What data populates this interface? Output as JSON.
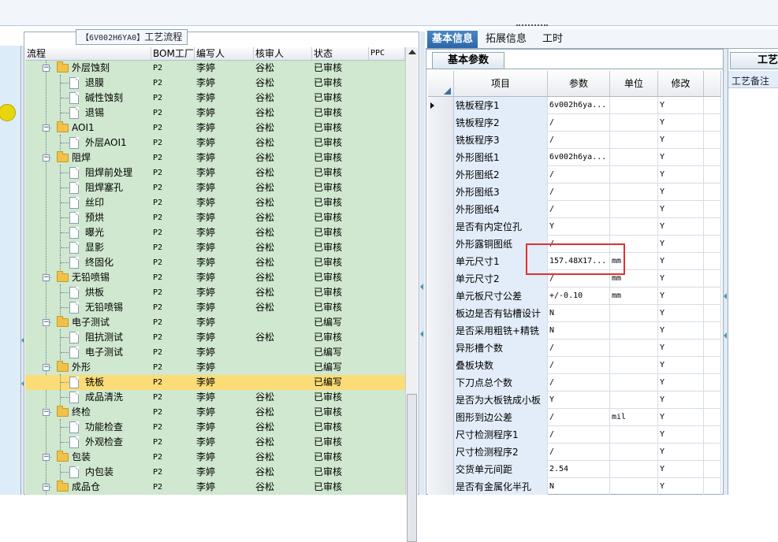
{
  "tree": {
    "caption_prefix": "【6V002H6YA0】",
    "caption_suffix": "工艺流程",
    "columns": [
      "流程",
      "BOM工厂",
      "编写人",
      "核审人",
      "状态",
      "PPC"
    ],
    "rows": [
      {
        "label": "外层蚀刻",
        "type": "folder",
        "bom": "P2",
        "writer": "李婷",
        "reviewer": "谷松",
        "status": "已审核"
      },
      {
        "label": "退膜",
        "type": "doc",
        "bom": "P2",
        "writer": "李婷",
        "reviewer": "谷松",
        "status": "已审核"
      },
      {
        "label": "碱性蚀刻",
        "type": "doc",
        "bom": "P2",
        "writer": "李婷",
        "reviewer": "谷松",
        "status": "已审核"
      },
      {
        "label": "退锡",
        "type": "doc",
        "bom": "P2",
        "writer": "李婷",
        "reviewer": "谷松",
        "status": "已审核"
      },
      {
        "label": "AOI1",
        "type": "folder",
        "bom": "P2",
        "writer": "李婷",
        "reviewer": "谷松",
        "status": "已审核"
      },
      {
        "label": "外层AOI1",
        "type": "doc",
        "bom": "P2",
        "writer": "李婷",
        "reviewer": "谷松",
        "status": "已审核"
      },
      {
        "label": "阻焊",
        "type": "folder",
        "bom": "P2",
        "writer": "李婷",
        "reviewer": "谷松",
        "status": "已审核"
      },
      {
        "label": "阻焊前处理",
        "type": "doc",
        "bom": "P2",
        "writer": "李婷",
        "reviewer": "谷松",
        "status": "已审核"
      },
      {
        "label": "阻焊塞孔",
        "type": "doc",
        "bom": "P2",
        "writer": "李婷",
        "reviewer": "谷松",
        "status": "已审核"
      },
      {
        "label": "丝印",
        "type": "doc",
        "bom": "P2",
        "writer": "李婷",
        "reviewer": "谷松",
        "status": "已审核"
      },
      {
        "label": "预烘",
        "type": "doc",
        "bom": "P2",
        "writer": "李婷",
        "reviewer": "谷松",
        "status": "已审核"
      },
      {
        "label": "曝光",
        "type": "doc",
        "bom": "P2",
        "writer": "李婷",
        "reviewer": "谷松",
        "status": "已审核"
      },
      {
        "label": "显影",
        "type": "doc",
        "bom": "P2",
        "writer": "李婷",
        "reviewer": "谷松",
        "status": "已审核"
      },
      {
        "label": "终固化",
        "type": "doc",
        "bom": "P2",
        "writer": "李婷",
        "reviewer": "谷松",
        "status": "已审核"
      },
      {
        "label": "无铅喷锡",
        "type": "folder",
        "bom": "P2",
        "writer": "李婷",
        "reviewer": "谷松",
        "status": "已审核"
      },
      {
        "label": "烘板",
        "type": "doc",
        "bom": "P2",
        "writer": "李婷",
        "reviewer": "谷松",
        "status": "已审核"
      },
      {
        "label": "无铅喷锡",
        "type": "doc",
        "bom": "P2",
        "writer": "李婷",
        "reviewer": "谷松",
        "status": "已审核"
      },
      {
        "label": "电子测试",
        "type": "folder",
        "bom": "P2",
        "writer": "李婷",
        "reviewer": "",
        "status": "已编写"
      },
      {
        "label": "阻抗测试",
        "type": "doc",
        "bom": "P2",
        "writer": "李婷",
        "reviewer": "谷松",
        "status": "已审核"
      },
      {
        "label": "电子测试",
        "type": "doc",
        "bom": "P2",
        "writer": "李婷",
        "reviewer": "",
        "status": "已编写"
      },
      {
        "label": "外形",
        "type": "folder",
        "bom": "P2",
        "writer": "李婷",
        "reviewer": "",
        "status": "已编写"
      },
      {
        "label": "铣板",
        "type": "doc",
        "bom": "P2",
        "writer": "李婷",
        "reviewer": "",
        "status": "已编写",
        "selected": true
      },
      {
        "label": "成品清洗",
        "type": "doc",
        "bom": "P2",
        "writer": "李婷",
        "reviewer": "谷松",
        "status": "已审核"
      },
      {
        "label": "终检",
        "type": "folder",
        "bom": "P2",
        "writer": "李婷",
        "reviewer": "谷松",
        "status": "已审核"
      },
      {
        "label": "功能检查",
        "type": "doc",
        "bom": "P2",
        "writer": "李婷",
        "reviewer": "谷松",
        "status": "已审核"
      },
      {
        "label": "外观检查",
        "type": "doc",
        "bom": "P2",
        "writer": "李婷",
        "reviewer": "谷松",
        "status": "已审核"
      },
      {
        "label": "包装",
        "type": "folder",
        "bom": "P2",
        "writer": "李婷",
        "reviewer": "谷松",
        "status": "已审核"
      },
      {
        "label": "内包装",
        "type": "doc",
        "bom": "P2",
        "writer": "李婷",
        "reviewer": "谷松",
        "status": "已审核"
      },
      {
        "label": "成品仓",
        "type": "folder",
        "bom": "P2",
        "writer": "李婷",
        "reviewer": "谷松",
        "status": "已审核"
      }
    ]
  },
  "tabs": [
    "基本信息",
    "拓展信息",
    "工时"
  ],
  "params": {
    "subtab": "基本参数",
    "columns": [
      "项目",
      "参数",
      "单位",
      "修改"
    ],
    "rows": [
      {
        "name": "铣板程序1",
        "value": "6v002h6ya...",
        "unit": "",
        "mod": "Y",
        "current": true
      },
      {
        "name": "铣板程序2",
        "value": "/",
        "unit": "",
        "mod": "Y"
      },
      {
        "name": "铣板程序3",
        "value": "/",
        "unit": "",
        "mod": "Y"
      },
      {
        "name": "外形图纸1",
        "value": "6v002h6ya...",
        "unit": "",
        "mod": "Y"
      },
      {
        "name": "外形图纸2",
        "value": "/",
        "unit": "",
        "mod": "Y"
      },
      {
        "name": "外形图纸3",
        "value": "/",
        "unit": "",
        "mod": "Y"
      },
      {
        "name": "外形图纸4",
        "value": "/",
        "unit": "",
        "mod": "Y"
      },
      {
        "name": "是否有内定位孔",
        "value": "Y",
        "unit": "",
        "mod": "Y"
      },
      {
        "name": "外形露铜图纸",
        "value": "/",
        "unit": "",
        "mod": "Y"
      },
      {
        "name": "单元尺寸1",
        "value": "157.48X17...",
        "unit": "mm",
        "mod": "Y"
      },
      {
        "name": "单元尺寸2",
        "value": "/",
        "unit": "mm",
        "mod": "Y"
      },
      {
        "name": "单元板尺寸公差",
        "value": "+/-0.10",
        "unit": "mm",
        "mod": "Y"
      },
      {
        "name": "板边是否有钻槽设计",
        "value": "N",
        "unit": "",
        "mod": "Y"
      },
      {
        "name": "是否采用粗铣+精铣",
        "value": "N",
        "unit": "",
        "mod": "Y"
      },
      {
        "name": "异形槽个数",
        "value": "/",
        "unit": "",
        "mod": "Y"
      },
      {
        "name": "叠板块数",
        "value": "/",
        "unit": "",
        "mod": "Y"
      },
      {
        "name": "下刀点总个数",
        "value": "/",
        "unit": "",
        "mod": "Y"
      },
      {
        "name": "是否为大板铣成小板",
        "value": "Y",
        "unit": "",
        "mod": "Y"
      },
      {
        "name": "图形到边公差",
        "value": "/",
        "unit": "mil",
        "mod": "Y"
      },
      {
        "name": "尺寸检测程序1",
        "value": "/",
        "unit": "",
        "mod": "Y"
      },
      {
        "name": "尺寸检测程序2",
        "value": "/",
        "unit": "",
        "mod": "Y"
      },
      {
        "name": "交货单元间距",
        "value": "2.54",
        "unit": "",
        "mod": "Y"
      },
      {
        "name": "是否有金属化半孔",
        "value": "N",
        "unit": "",
        "mod": "Y"
      }
    ]
  },
  "notes": {
    "tab": "工艺",
    "label": "工艺备注"
  },
  "colors": {
    "tree_bg": "#cfe8cf",
    "selected_row": "#fbdc76",
    "active_tab": "#2a66a8",
    "highlight": "#e03030"
  }
}
